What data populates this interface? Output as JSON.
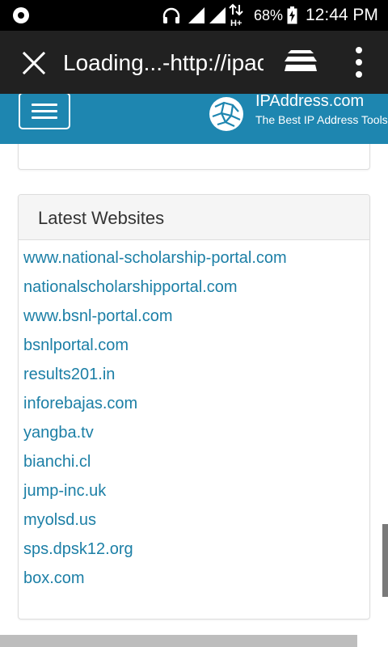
{
  "status_bar": {
    "battery_percent": "68%",
    "time": "12:44 PM",
    "icons": [
      "app-notification-icon",
      "headphones-icon",
      "signal-icon",
      "signal-icon",
      "data-hplus-icon",
      "battery-charging-icon"
    ]
  },
  "browser": {
    "page_title": "Loading...-http://ipaddress.com",
    "buttons": [
      "close-icon",
      "tab-stack-icon",
      "overflow-menu-icon"
    ]
  },
  "site_header": {
    "brand_name": "IPAddress.com",
    "tagline": "The Best IP Address Tools",
    "accent_color": "#1e86b0"
  },
  "latest_websites": {
    "heading": "Latest Websites",
    "link_color": "#1c7fa6",
    "items": [
      "www.national-scholarship-portal.com",
      "nationalscholarshipportal.com",
      "www.bsnl-portal.com",
      "bsnlportal.com",
      "results201.in",
      "inforebajas.com",
      "yangba.tv",
      "bianchi.cl",
      "jump-inc.uk",
      "myolsd.us",
      "sps.dpsk12.org",
      "box.com"
    ]
  }
}
